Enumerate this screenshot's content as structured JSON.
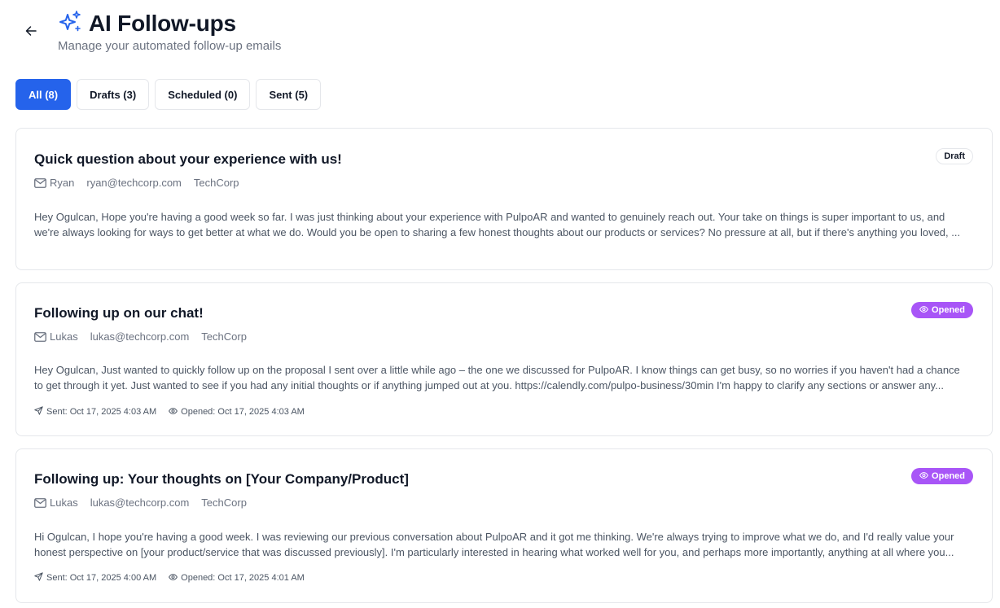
{
  "header": {
    "title": "AI Follow-ups",
    "subtitle": "Manage your automated follow-up emails",
    "back_icon": "arrow-left-icon",
    "title_icon": "sparkles-icon"
  },
  "tabs": [
    {
      "label": "All (8)",
      "active": true
    },
    {
      "label": "Drafts (3)",
      "active": false
    },
    {
      "label": "Scheduled (0)",
      "active": false
    },
    {
      "label": "Sent (5)",
      "active": false
    }
  ],
  "colors": {
    "accent": "#2563eb",
    "opened_badge": "#a855f7"
  },
  "emails": [
    {
      "title": "Quick question about your experience with us!",
      "name": "Ryan",
      "email": "ryan@techcorp.com",
      "company": "TechCorp",
      "status": "Draft",
      "body": "Hey Ogulcan, Hope you're having a good week so far. I was just thinking about your experience with PulpoAR and wanted to genuinely reach out. Your take on things is super important to us, and we're always looking for ways to get better at what we do. Would you be open to sharing a few honest thoughts about our products or services? No pressure at all, but if there's anything you loved, ..."
    },
    {
      "title": "Following up on our chat!",
      "name": "Lukas",
      "email": "lukas@techcorp.com",
      "company": "TechCorp",
      "status": "Opened",
      "body": "Hey Ogulcan, Just wanted to quickly follow up on the proposal I sent over a little while ago – the one we discussed for PulpoAR. I know things can get busy, so no worries if you haven't had a chance to get through it yet. Just wanted to see if you had any initial thoughts or if anything jumped out at you. https://calendly.com/pulpo-business/30min I'm happy to clarify any sections or answer any...",
      "sent": "Sent: Oct 17, 2025 4:03 AM",
      "opened": "Opened: Oct 17, 2025 4:03 AM"
    },
    {
      "title": "Following up: Your thoughts on [Your Company/Product]",
      "name": "Lukas",
      "email": "lukas@techcorp.com",
      "company": "TechCorp",
      "status": "Opened",
      "body": "Hi Ogulcan, I hope you're having a good week. I was reviewing our previous conversation about PulpoAR and it got me thinking. We're always trying to improve what we do, and I'd really value your honest perspective on [your product/service that was discussed previously]. I'm particularly interested in hearing what worked well for you, and perhaps more importantly, anything at all where you...",
      "sent": "Sent: Oct 17, 2025 4:00 AM",
      "opened": "Opened: Oct 17, 2025 4:01 AM"
    }
  ]
}
